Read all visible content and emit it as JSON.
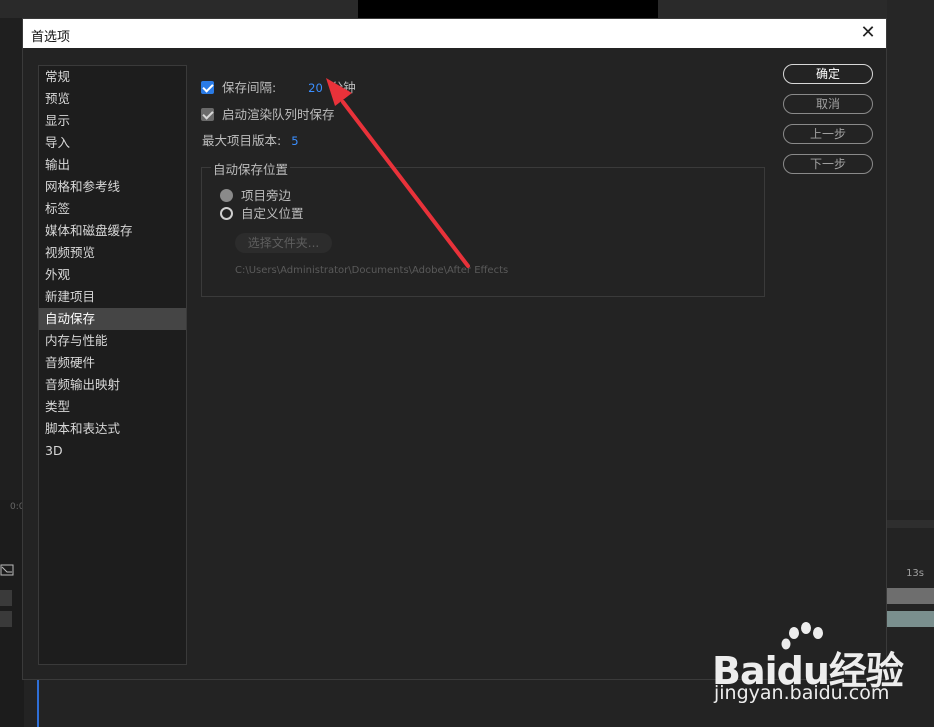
{
  "background": {
    "timecode_right": "13s",
    "timecode_left": "0:0"
  },
  "dialog": {
    "title": "首选项",
    "close_icon": "close-icon"
  },
  "sidebar": {
    "items": [
      {
        "label": "常规"
      },
      {
        "label": "预览"
      },
      {
        "label": "显示"
      },
      {
        "label": "导入"
      },
      {
        "label": "输出"
      },
      {
        "label": "网格和参考线"
      },
      {
        "label": "标签"
      },
      {
        "label": "媒体和磁盘缓存"
      },
      {
        "label": "视频预览"
      },
      {
        "label": "外观"
      },
      {
        "label": "新建项目"
      },
      {
        "label": "自动保存",
        "selected": true
      },
      {
        "label": "内存与性能"
      },
      {
        "label": "音频硬件"
      },
      {
        "label": "音频输出映射"
      },
      {
        "label": "类型"
      },
      {
        "label": "脚本和表达式"
      },
      {
        "label": "3D"
      }
    ]
  },
  "autosave": {
    "save_interval_label": "保存间隔:",
    "save_interval_checked": true,
    "interval_value": "20",
    "interval_unit": "分钟",
    "render_queue_label": "启动渲染队列时保存",
    "render_queue_checked": true,
    "max_versions_label": "最大项目版本:",
    "max_versions_value": "5",
    "location_group_label": "自动保存位置",
    "option_next_to_project": "项目旁边",
    "option_custom_location": "自定义位置",
    "choose_folder_label": "选择文件夹...",
    "path": "C:\\Users\\Administrator\\Documents\\Adobe\\After Effects"
  },
  "buttons": {
    "ok": "确定",
    "cancel": "取消",
    "previous": "上一步",
    "next": "下一步"
  },
  "annotation": {
    "arrow_color": "#e8323a"
  },
  "watermark": {
    "brand": "Baidu经验",
    "url": "jingyan.baidu.com"
  },
  "colors": {
    "accent_blue": "#2a7be6",
    "value_blue": "#3b8fff",
    "dialog_bg": "#232323"
  }
}
